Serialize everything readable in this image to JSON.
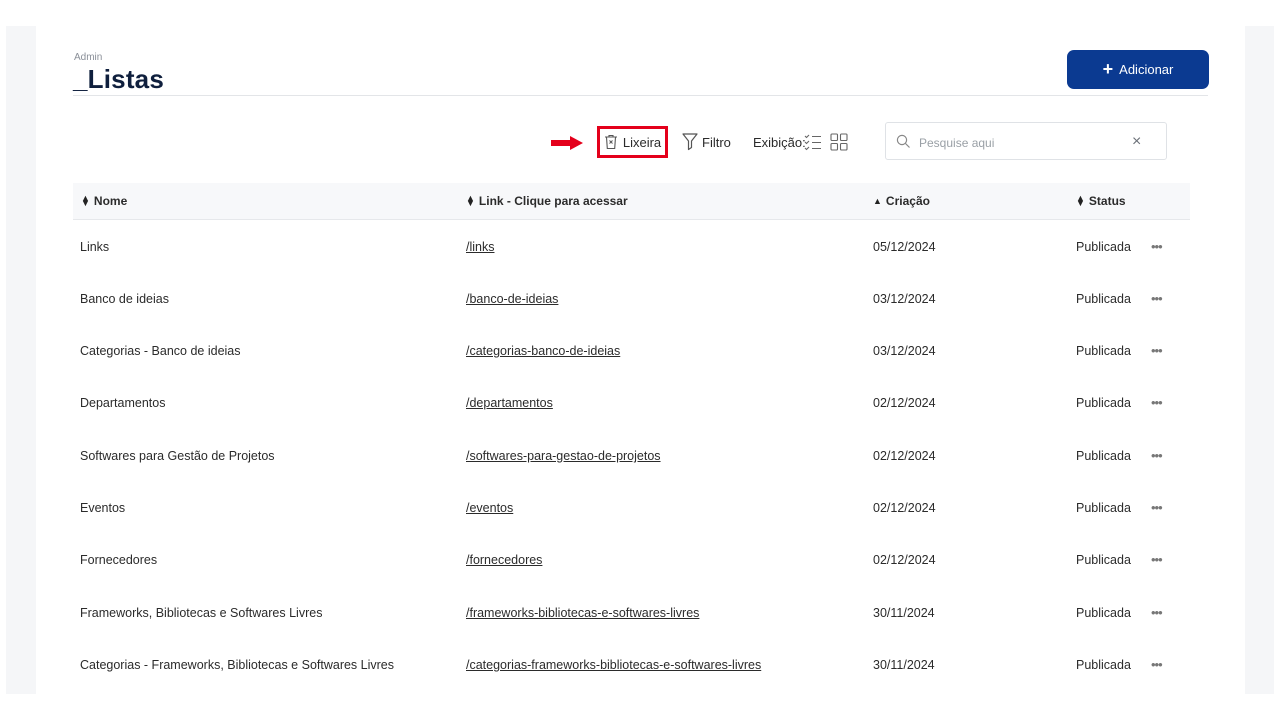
{
  "breadcrumb": "Admin",
  "page_title": "_Listas",
  "add_button": {
    "icon": "plus-icon",
    "label": "Adicionar"
  },
  "toolbar": {
    "trash_label": "Lixeira",
    "filter_label": "Filtro",
    "view_label": "Exibição:"
  },
  "search": {
    "placeholder": "Pesquise aqui",
    "value": "",
    "clear": "×"
  },
  "table": {
    "headers": {
      "name": "Nome",
      "link": "Link - Clique para acessar",
      "created": "Criação",
      "status": "Status"
    },
    "rows": [
      {
        "name": "Links",
        "link": "/links",
        "created": "05/12/2024",
        "status": "Publicada"
      },
      {
        "name": "Banco de ideias",
        "link": "/banco-de-ideias",
        "created": "03/12/2024",
        "status": "Publicada"
      },
      {
        "name": "Categorias - Banco de ideias",
        "link": "/categorias-banco-de-ideias",
        "created": "03/12/2024",
        "status": "Publicada"
      },
      {
        "name": "Departamentos",
        "link": "/departamentos",
        "created": "02/12/2024",
        "status": "Publicada"
      },
      {
        "name": "Softwares para Gestão de Projetos",
        "link": "/softwares-para-gestao-de-projetos",
        "created": "02/12/2024",
        "status": "Publicada"
      },
      {
        "name": "Eventos",
        "link": "/eventos",
        "created": "02/12/2024",
        "status": "Publicada"
      },
      {
        "name": "Fornecedores",
        "link": "/fornecedores",
        "created": "02/12/2024",
        "status": "Publicada"
      },
      {
        "name": "Frameworks, Bibliotecas e Softwares Livres",
        "link": "/frameworks-bibliotecas-e-softwares-livres",
        "created": "30/11/2024",
        "status": "Publicada"
      },
      {
        "name": "Categorias - Frameworks, Bibliotecas e Softwares Livres",
        "link": "/categorias-frameworks-bibliotecas-e-softwares-livres",
        "created": "30/11/2024",
        "status": "Publicada"
      }
    ]
  },
  "colors": {
    "primary": "#0b3a91",
    "highlight": "#e4001b",
    "title": "#0f1f3d"
  }
}
